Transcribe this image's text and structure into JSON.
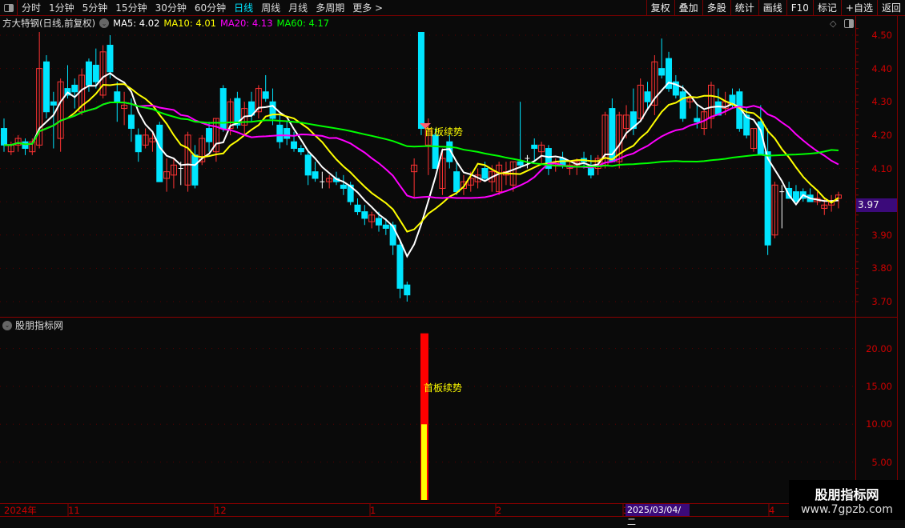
{
  "toolbar": {
    "periods": [
      "分时",
      "1分钟",
      "5分钟",
      "15分钟",
      "30分钟",
      "60分钟",
      "日线",
      "周线",
      "月线",
      "多周期",
      "更多 >"
    ],
    "active": "日线",
    "right_buttons": [
      "复权",
      "叠加",
      "多股",
      "统计",
      "画线",
      "F10",
      "标记",
      "+自选",
      "返回"
    ]
  },
  "legend": {
    "title": "方大特钢(日线,前复权)",
    "ma5": "MA5: 4.02",
    "ma10": "MA10: 4.01",
    "ma20": "MA20: 4.13",
    "ma60": "MA60: 4.17",
    "colors": {
      "ma5": "#ffffff",
      "ma10": "#ffff00",
      "ma20": "#ff00ff",
      "ma60": "#00ff00",
      "up": "#ff3333",
      "down": "#00e5ff"
    }
  },
  "price_axis": {
    "ticks": [
      "4.50",
      "4.40",
      "4.30",
      "4.20",
      "4.10",
      "3.90",
      "3.80",
      "3.70"
    ],
    "current": "3.97"
  },
  "indicator": {
    "title": "股朋指标网",
    "ticks": [
      "20.00",
      "15.00",
      "10.00",
      "5.00"
    ],
    "signal_label": "首板续势",
    "bar_total": 22,
    "bar_inner": 10
  },
  "signal_label_main": "首板续势",
  "date_axis": {
    "labels": [
      "2024年",
      "11",
      "12",
      "1",
      "2",
      "3",
      "4"
    ],
    "highlight": "2025/03/04/二"
  },
  "watermark": {
    "title": "股朋指标网",
    "url": "www.7gpzb.com"
  },
  "chart_data": {
    "type": "candlestick",
    "ylim": [
      3.68,
      4.52
    ],
    "grid": true,
    "candles": [
      [
        4.22,
        4.25,
        4.15,
        4.17
      ],
      [
        4.15,
        4.18,
        4.14,
        4.17
      ],
      [
        4.17,
        4.2,
        4.15,
        4.19
      ],
      [
        4.18,
        4.19,
        4.14,
        4.16
      ],
      [
        4.15,
        4.19,
        4.14,
        4.18
      ],
      [
        4.17,
        4.51,
        4.16,
        4.4
      ],
      [
        4.42,
        4.44,
        4.25,
        4.27
      ],
      [
        4.3,
        4.33,
        4.16,
        4.29
      ],
      [
        4.19,
        4.37,
        4.15,
        4.36
      ],
      [
        4.34,
        4.41,
        4.31,
        4.32
      ],
      [
        4.35,
        4.37,
        4.28,
        4.33
      ],
      [
        4.27,
        4.4,
        4.26,
        4.38
      ],
      [
        4.42,
        4.43,
        4.33,
        4.35
      ],
      [
        4.41,
        4.46,
        4.34,
        4.36
      ],
      [
        4.32,
        4.47,
        4.31,
        4.45
      ],
      [
        4.47,
        4.5,
        4.37,
        4.39
      ],
      [
        4.33,
        4.36,
        4.24,
        4.3
      ],
      [
        4.28,
        4.33,
        4.23,
        4.29
      ],
      [
        4.26,
        4.31,
        4.18,
        4.22
      ],
      [
        4.2,
        4.22,
        4.12,
        4.15
      ],
      [
        4.17,
        4.22,
        4.16,
        4.2
      ],
      [
        4.18,
        4.21,
        4.15,
        4.19
      ],
      [
        4.23,
        4.24,
        4.06,
        4.06
      ],
      [
        4.07,
        4.13,
        4.03,
        4.09
      ],
      [
        4.08,
        4.13,
        4.04,
        4.11
      ],
      [
        4.1,
        4.12,
        4.05,
        4.1
      ],
      [
        4.05,
        4.21,
        4.03,
        4.2
      ],
      [
        4.14,
        4.17,
        4.04,
        4.05
      ],
      [
        4.12,
        4.2,
        4.11,
        4.19
      ],
      [
        4.22,
        4.24,
        4.15,
        4.18
      ],
      [
        4.15,
        4.25,
        4.12,
        4.25
      ],
      [
        4.34,
        4.35,
        4.21,
        4.22
      ],
      [
        4.22,
        4.31,
        4.2,
        4.3
      ],
      [
        4.31,
        4.33,
        4.22,
        4.23
      ],
      [
        4.23,
        4.3,
        4.2,
        4.28
      ],
      [
        4.3,
        4.33,
        4.24,
        4.26
      ],
      [
        4.27,
        4.35,
        4.25,
        4.34
      ],
      [
        4.33,
        4.38,
        4.3,
        4.31
      ],
      [
        4.3,
        4.34,
        4.23,
        4.25
      ],
      [
        4.23,
        4.26,
        4.16,
        4.18
      ],
      [
        4.22,
        4.24,
        4.17,
        4.19
      ],
      [
        4.18,
        4.21,
        4.15,
        4.16
      ],
      [
        4.16,
        4.17,
        4.14,
        4.15
      ],
      [
        4.14,
        4.15,
        4.05,
        4.08
      ],
      [
        4.09,
        4.12,
        4.06,
        4.07
      ],
      [
        4.06,
        4.09,
        4.04,
        4.06
      ],
      [
        4.06,
        4.08,
        4.04,
        4.07
      ],
      [
        4.07,
        4.09,
        4.05,
        4.06
      ],
      [
        4.05,
        4.08,
        4.02,
        4.04
      ],
      [
        4.05,
        4.06,
        3.99,
        4.0
      ],
      [
        3.99,
        4.01,
        3.96,
        3.97
      ],
      [
        3.97,
        3.99,
        3.93,
        3.95
      ],
      [
        3.94,
        3.97,
        3.92,
        3.96
      ],
      [
        3.95,
        3.97,
        3.91,
        3.93
      ],
      [
        3.93,
        3.95,
        3.9,
        3.92
      ],
      [
        3.93,
        3.94,
        3.84,
        3.87
      ],
      [
        3.87,
        3.88,
        3.71,
        3.74
      ],
      [
        3.75,
        3.76,
        3.7,
        3.72
      ],
      [
        4.09,
        4.13,
        4.01,
        4.11
      ],
      [
        4.6,
        4.6,
        4.2,
        4.22
      ],
      [
        4.17,
        4.25,
        4.08,
        4.22
      ],
      [
        4.2,
        4.22,
        4.1,
        4.1
      ],
      [
        4.04,
        4.16,
        4.02,
        4.13
      ],
      [
        4.18,
        4.2,
        4.1,
        4.12
      ],
      [
        4.09,
        4.12,
        4.02,
        4.03
      ],
      [
        4.04,
        4.08,
        4.02,
        4.06
      ],
      [
        4.05,
        4.09,
        4.03,
        4.07
      ],
      [
        4.06,
        4.1,
        4.04,
        4.08
      ],
      [
        4.1,
        4.12,
        4.06,
        4.07
      ],
      [
        4.06,
        4.11,
        4.03,
        4.09
      ],
      [
        4.03,
        4.12,
        4.02,
        4.11
      ],
      [
        4.08,
        4.12,
        4.05,
        4.09
      ],
      [
        4.05,
        4.12,
        4.03,
        4.12
      ],
      [
        4.12,
        4.3,
        4.1,
        4.11
      ],
      [
        4.13,
        4.14,
        4.1,
        4.13
      ],
      [
        4.17,
        4.19,
        4.12,
        4.16
      ],
      [
        4.15,
        4.18,
        4.11,
        4.17
      ],
      [
        4.16,
        4.17,
        4.08,
        4.1
      ],
      [
        4.11,
        4.13,
        4.09,
        4.12
      ],
      [
        4.13,
        4.15,
        4.1,
        4.11
      ],
      [
        4.1,
        4.12,
        4.08,
        4.11
      ],
      [
        4.11,
        4.13,
        4.08,
        4.12
      ],
      [
        4.13,
        4.15,
        4.1,
        4.12
      ],
      [
        4.1,
        4.14,
        4.07,
        4.08
      ],
      [
        4.1,
        4.14,
        4.08,
        4.13
      ],
      [
        4.11,
        4.27,
        4.1,
        4.26
      ],
      [
        4.28,
        4.31,
        4.12,
        4.12
      ],
      [
        4.12,
        4.27,
        4.1,
        4.26
      ],
      [
        4.22,
        4.29,
        4.19,
        4.26
      ],
      [
        4.27,
        4.34,
        4.2,
        4.22
      ],
      [
        4.25,
        4.37,
        4.24,
        4.35
      ],
      [
        4.33,
        4.36,
        4.28,
        4.3
      ],
      [
        4.29,
        4.44,
        4.26,
        4.42
      ],
      [
        4.4,
        4.49,
        4.37,
        4.38
      ],
      [
        4.43,
        4.45,
        4.33,
        4.34
      ],
      [
        4.36,
        4.38,
        4.31,
        4.32
      ],
      [
        4.33,
        4.35,
        4.24,
        4.25
      ],
      [
        4.3,
        4.32,
        4.28,
        4.31
      ],
      [
        4.25,
        4.29,
        4.22,
        4.24
      ],
      [
        4.22,
        4.28,
        4.2,
        4.27
      ],
      [
        4.25,
        4.36,
        4.22,
        4.35
      ],
      [
        4.3,
        4.34,
        4.26,
        4.26
      ],
      [
        4.28,
        4.33,
        4.26,
        4.3
      ],
      [
        4.32,
        4.34,
        4.28,
        4.29
      ],
      [
        4.33,
        4.34,
        4.21,
        4.22
      ],
      [
        4.26,
        4.28,
        4.19,
        4.2
      ],
      [
        4.16,
        4.22,
        4.15,
        4.22
      ],
      [
        4.24,
        4.29,
        4.14,
        4.14
      ],
      [
        4.15,
        4.22,
        3.84,
        3.87
      ],
      [
        3.9,
        4.06,
        3.89,
        4.05
      ],
      [
        4.03,
        4.05,
        3.92,
        4.03
      ],
      [
        4.04,
        4.06,
        4.01,
        4.01
      ],
      [
        4.03,
        4.05,
        4.0,
        4.0
      ],
      [
        4.03,
        4.04,
        4.0,
        4.01
      ],
      [
        4.02,
        4.04,
        4.0,
        4.0
      ],
      [
        4.0,
        4.03,
        3.99,
        4.01
      ],
      [
        3.98,
        4.01,
        3.96,
        3.99
      ],
      [
        3.99,
        4.02,
        3.97,
        4.0
      ],
      [
        4.01,
        4.03,
        3.98,
        4.02
      ]
    ]
  }
}
